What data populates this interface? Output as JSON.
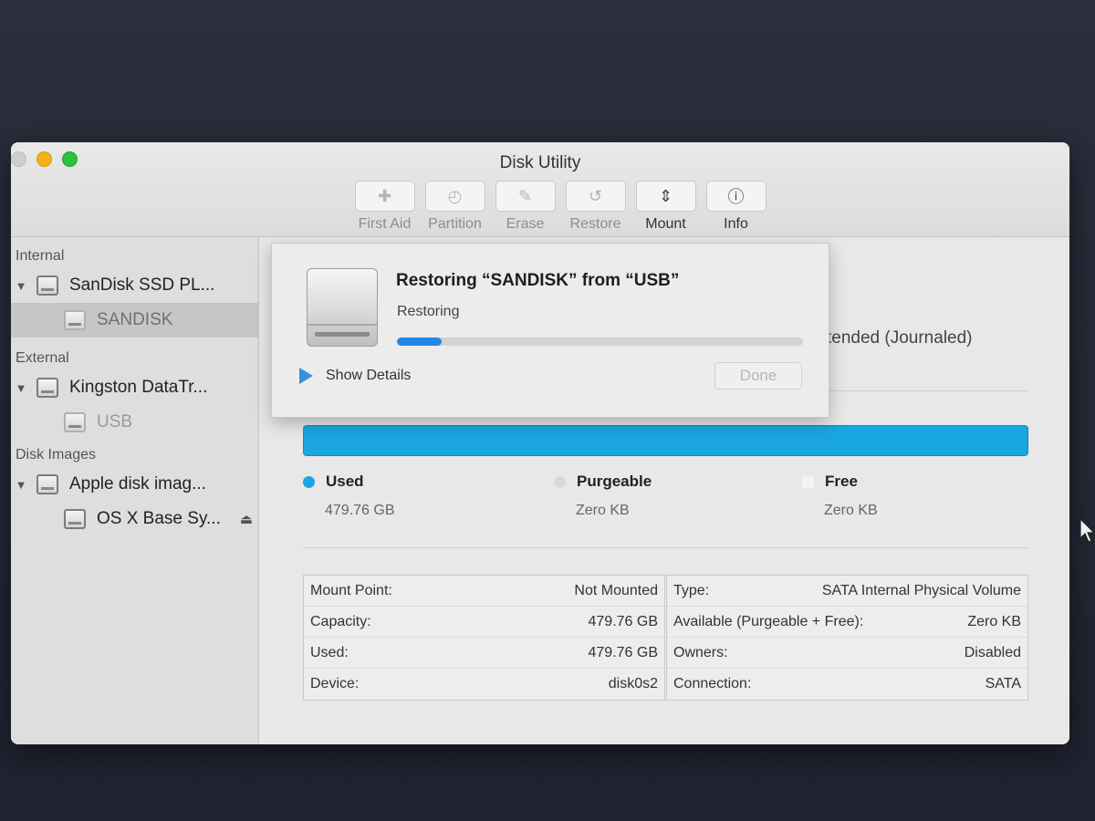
{
  "window": {
    "title": "Disk Utility"
  },
  "toolbar": [
    {
      "label": "First Aid",
      "icon": "stethoscope-icon",
      "glyph": "✚",
      "enabled": false
    },
    {
      "label": "Partition",
      "icon": "pie-icon",
      "glyph": "◴",
      "enabled": false
    },
    {
      "label": "Erase",
      "icon": "erase-icon",
      "glyph": "✎",
      "enabled": false
    },
    {
      "label": "Restore",
      "icon": "restore-icon",
      "glyph": "↺",
      "enabled": false
    },
    {
      "label": "Mount",
      "icon": "mount-icon",
      "glyph": "⇕",
      "enabled": true
    },
    {
      "label": "Info",
      "icon": "info-icon",
      "glyph": "ⓘ",
      "enabled": true
    }
  ],
  "sidebar": {
    "internal_label": "Internal",
    "internal_disk": "SanDisk SSD PL...",
    "internal_volume": "SANDISK",
    "external_label": "External",
    "external_disk": "Kingston DataTr...",
    "external_volume": "USB",
    "images_label": "Disk Images",
    "image_disk": "Apple disk imag...",
    "image_volume": "OS X Base Sy..."
  },
  "main": {
    "format_partial": "tended (Journaled)",
    "legend": {
      "used": {
        "name": "Used",
        "value": "479.76 GB",
        "color": "#1aa6e0"
      },
      "purgeable": {
        "name": "Purgeable",
        "value": "Zero KB",
        "color": "#d8d8d8"
      },
      "free": {
        "name": "Free",
        "value": "Zero KB",
        "color": "#f4f4f4"
      }
    },
    "info_left": [
      {
        "key": "Mount Point:",
        "value": "Not Mounted"
      },
      {
        "key": "Capacity:",
        "value": "479.76 GB"
      },
      {
        "key": "Used:",
        "value": "479.76 GB"
      },
      {
        "key": "Device:",
        "value": "disk0s2"
      }
    ],
    "info_right": [
      {
        "key": "Type:",
        "value": "SATA Internal Physical Volume"
      },
      {
        "key": "Available (Purgeable + Free):",
        "value": "Zero KB"
      },
      {
        "key": "Owners:",
        "value": "Disabled"
      },
      {
        "key": "Connection:",
        "value": "SATA"
      }
    ]
  },
  "sheet": {
    "title": "Restoring “SANDISK” from “USB”",
    "status": "Restoring",
    "progress_fraction": 0.11,
    "show_details_label": "Show Details",
    "done_label": "Done"
  }
}
